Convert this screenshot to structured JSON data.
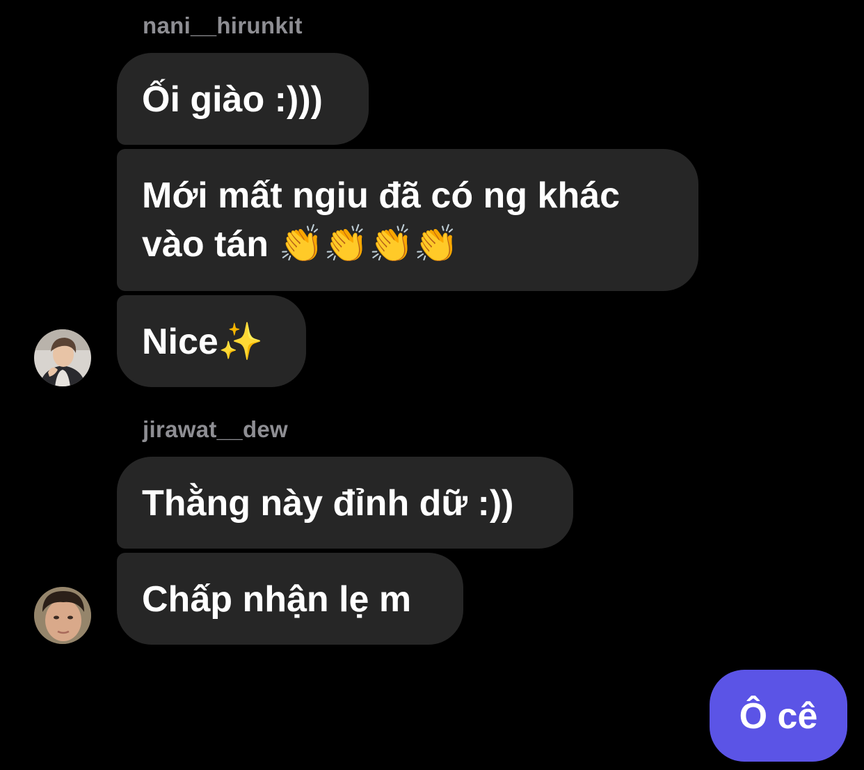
{
  "thread": {
    "group1": {
      "sender": "nani__hirunkit",
      "messages": [
        "Ối giào :)))",
        "Mới mất ngiu đã có ng khác\nvào tán 👏👏👏👏",
        "Nice✨"
      ],
      "avatar_icon": "profile-photo"
    },
    "group2": {
      "sender": "jirawat__dew",
      "messages": [
        "Thằng này đỉnh dữ :))",
        "Chấp nhận lẹ m"
      ],
      "avatar_icon": "profile-photo"
    },
    "outgoing": {
      "messages": [
        "Ô cê"
      ]
    }
  },
  "colors": {
    "background": "#000000",
    "incoming_bubble": "#262626",
    "outgoing_bubble": "#5b54e6",
    "sender_name": "#8e8e93",
    "text": "#ffffff"
  }
}
